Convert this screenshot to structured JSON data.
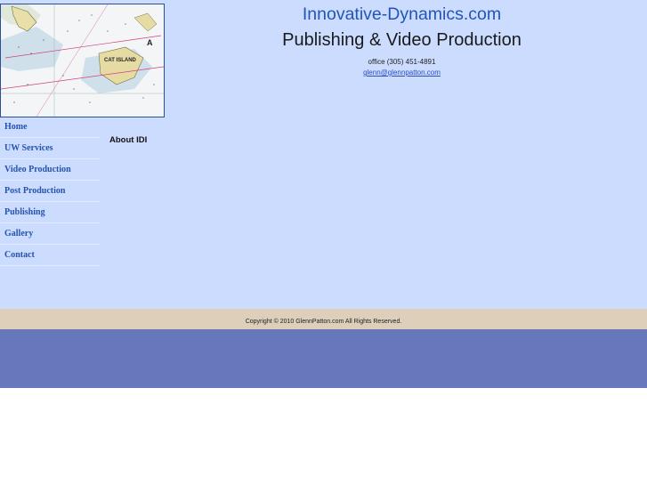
{
  "header": {
    "title": "Innovative-Dynamics.com",
    "subtitle": "Publishing & Video Production",
    "office": "office (305) 451-4891",
    "email": "glenn@glennpatton.com"
  },
  "map_image": {
    "labels": {
      "cat_island": "CAT ISLAND",
      "lettering_a": "A"
    }
  },
  "nav": {
    "items": [
      {
        "label": "Home"
      },
      {
        "label": "UW Services"
      },
      {
        "label": "Video Production"
      },
      {
        "label": "Post Production"
      },
      {
        "label": "Publishing"
      },
      {
        "label": "Gallery"
      },
      {
        "label": "Contact"
      }
    ]
  },
  "content": {
    "heading": "About IDI"
  },
  "footer": {
    "copyright": "Copyright © 2010 GlennPatton.com All Rights Reserved."
  },
  "colors": {
    "main_background": "#ccdcff",
    "footer_band": "#ddcfba",
    "bottom_band": "#6777bb",
    "title_blue": "#2255b8",
    "nav_link": "#2453b0"
  }
}
